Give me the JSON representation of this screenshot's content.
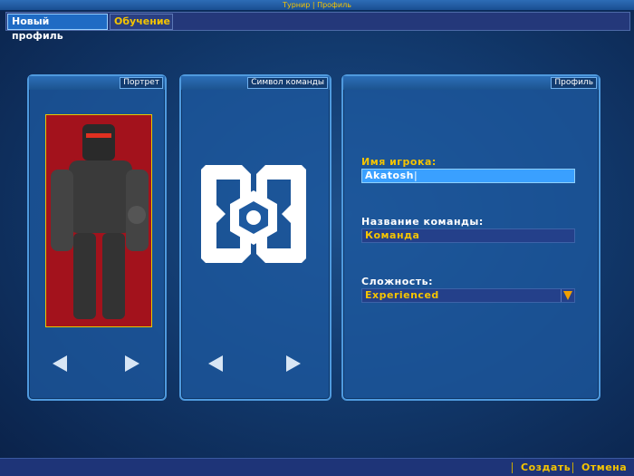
{
  "title": "Турнир | Профиль",
  "tabs": [
    {
      "label": "Новый профиль",
      "active": true
    },
    {
      "label": "Обучение",
      "active": false
    }
  ],
  "panels": {
    "portrait": "Портрет",
    "team_symbol": "Символ команды",
    "profile": "Профиль"
  },
  "form": {
    "player_name_label": "Имя игрока:",
    "player_name_value": "Akatosh",
    "team_name_label": "Название команды:",
    "team_name_value": "Команда",
    "difficulty_label": "Сложность:",
    "difficulty_value": "Experienced"
  },
  "footer": {
    "create": "Создать",
    "cancel": "Отмена"
  },
  "colors": {
    "accent": "#f5c400",
    "panel": "#1e5aa0",
    "selected_field": "#3aa0ff"
  }
}
